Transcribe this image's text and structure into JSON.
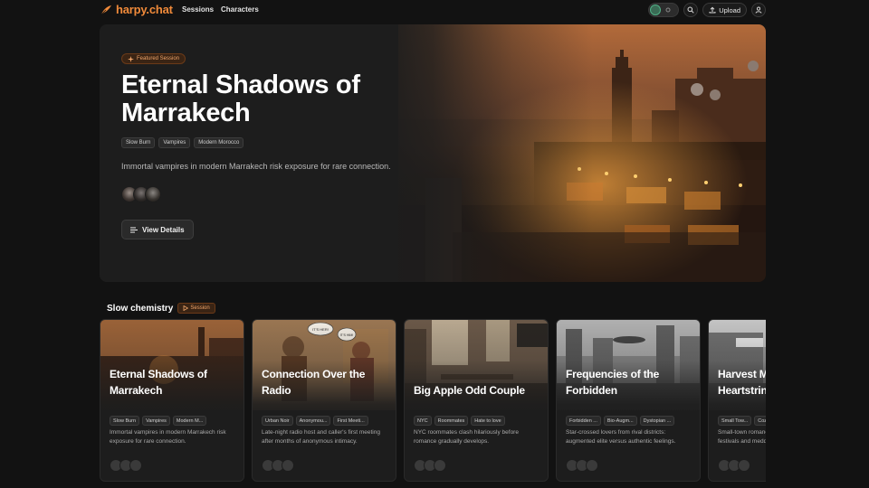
{
  "nav": {
    "brand": "harpy.chat",
    "links": [
      "Sessions",
      "Characters"
    ],
    "upload_label": "Upload",
    "brand_color": "#f08a3a"
  },
  "hero": {
    "badge": "Featured Session",
    "title": "Eternal Shadows of Marrakech",
    "tags": [
      "Slow Burn",
      "Vampires",
      "Modern Morocco"
    ],
    "description": "Immortal vampires in modern Marrakech risk exposure for rare connection.",
    "cta": "View Details"
  },
  "section": {
    "title": "Slow chemistry",
    "badge": "Session",
    "cards": [
      {
        "title": "Eternal Shadows of Marrakech",
        "tags": [
          "Slow Burn",
          "Vampires",
          "Modern M..."
        ],
        "description": "Immortal vampires in modern Marrakech risk exposure for rare connection."
      },
      {
        "title": "Connection Over the Radio",
        "tags": [
          "Urban Noir",
          "Anonymou...",
          "First Meeti..."
        ],
        "description": "Late-night radio host and caller's first meeting after months of anonymous intimacy.",
        "speech": [
          "IT'S HER!",
          "IT'S HIM!"
        ]
      },
      {
        "title": "Big Apple Odd Couple",
        "tags": [
          "NYC",
          "Roommates",
          "Hate to love"
        ],
        "description": "NYC roommates clash hilariously before romance gradually develops."
      },
      {
        "title": "Frequencies of the Forbidden",
        "tags": [
          "Forbidden ...",
          "Bio-Augm...",
          "Dystopian ..."
        ],
        "description": "Star-crossed lovers from rival districts: augmented elite versus authentic feelings."
      },
      {
        "title": "Harvest Moon Heartstrings",
        "tags": [
          "Small Tow...",
          "Cozy"
        ],
        "description": "Small-town romance blossoms through harvest festivals and meddling neighbors."
      }
    ]
  }
}
